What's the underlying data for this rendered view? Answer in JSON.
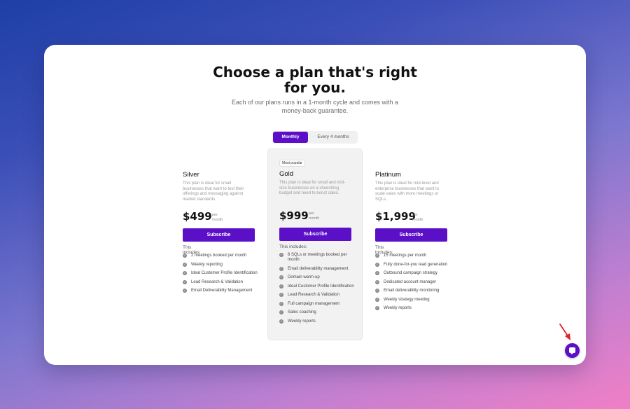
{
  "headline": {
    "line1": "Choose a plan that's right",
    "line2": "for you."
  },
  "subtitle": {
    "line1": "Each of our plans runs in a 1-month cycle and comes with a",
    "line2": "money-back guarantee."
  },
  "billing_toggle": {
    "active": "Monthly",
    "other": "Every 4 months"
  },
  "plans": [
    {
      "name": "Silver",
      "description": "This plan is ideal for small businesses that want to test their offerings and messaging against market standards",
      "price": "$499",
      "per_line1": "per",
      "per_line2": "month",
      "button": "Subscribe",
      "includes_label": "This includes:",
      "features": [
        "2 meetings booked per month",
        "Weekly reporting",
        "Ideal Customer Profile Identification",
        "Lead Research & Validation",
        "Email Deliverability Management"
      ]
    },
    {
      "badge": "Most popular",
      "name": "Gold",
      "description": "This plan is ideal for small and mid-size businesses on a shoestring budget and need to boost sales.",
      "price": "$999",
      "per_line1": "per",
      "per_line2": "month",
      "button": "Subscribe",
      "includes_label": "This includes:",
      "features": [
        "6 SQLs or meetings booked per month",
        "Email deliverability management",
        "Domain warm-up",
        "Ideal Customer Profile Identification",
        "Lead Research & Validation",
        "Full campaign management",
        "Sales coaching",
        "Weekly reports"
      ]
    },
    {
      "name": "Platinum",
      "description": "This plan is ideal for mid-level and enterprise businesses that want to scale sales with more meetings or SQLs.",
      "price": "$1,999",
      "per_line1": "per",
      "per_line2": "month",
      "button": "Subscribe",
      "includes_label": "This includes:",
      "features": [
        "15 meetings per month",
        "Fully done-for-you lead generation",
        "Outbound campaign strategy",
        "Dedicated account manager",
        "Email deliverability monitoring",
        "Weekly strategy meeting",
        "Weekly reports"
      ]
    }
  ],
  "icons": {
    "check": "check-circle-icon",
    "chat": "chat-bubble-icon",
    "annotation": "red-arrow-icon"
  },
  "colors": {
    "accent": "#5b0fc7",
    "annotation": "#e0202a"
  }
}
